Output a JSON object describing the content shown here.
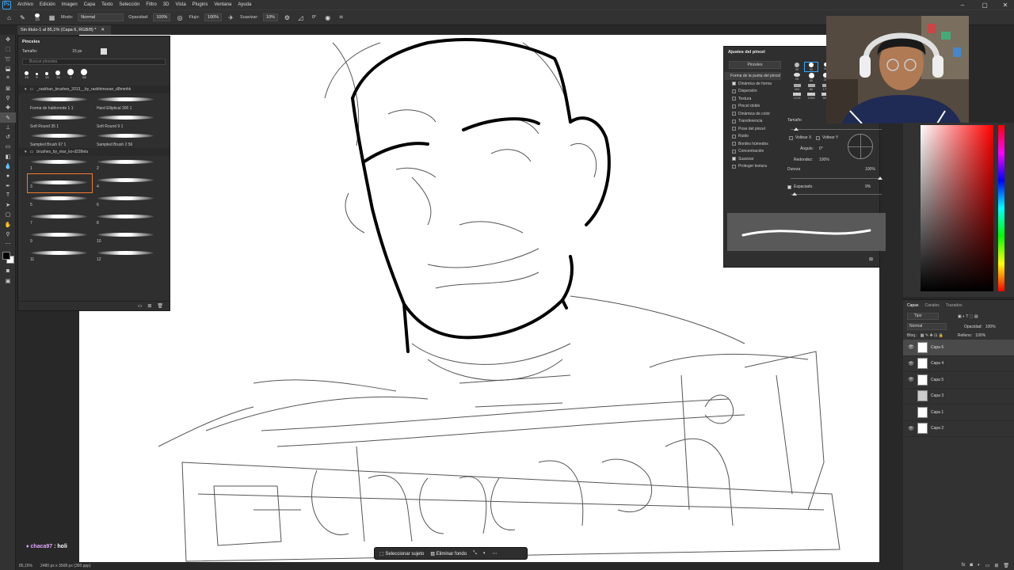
{
  "app": {
    "logo": "Ps",
    "menu": [
      "Archivo",
      "Edición",
      "Imagen",
      "Capa",
      "Texto",
      "Selección",
      "Filtro",
      "3D",
      "Vista",
      "Plugins",
      "Ventana",
      "Ayuda"
    ]
  },
  "options": {
    "brush_size": "15",
    "mode_label": "Modo:",
    "mode_value": "Normal",
    "opacity_label": "Opacidad:",
    "opacity_value": "100%",
    "flow_label": "Flujo:",
    "flow_value": "100%",
    "smooth_label": "Suavizar:",
    "smooth_value": "10%",
    "angle_value": "0°"
  },
  "document": {
    "tab_title": "Sin título-1 al 85,1% (Capa 6, RGB/8) *",
    "zoom": "85,15%",
    "dimensions": "2480 px x 3508 px (300 ppp)"
  },
  "brushes": {
    "title": "Pinceles",
    "size_label": "Tamaño:",
    "size_value": "15 px",
    "search_placeholder": "Buscar pinceles",
    "presets": [
      "15",
      "9",
      "13",
      "24",
      "1",
      "85"
    ],
    "group1": "_raskhan_brushes_2013__by_raskhimsean_d8mmhk",
    "group1_items": [
      "Forma de hablonnde 1 1",
      "Hard Elliptical 300 1",
      "Soft Round 35 1",
      "Soft Round 9 1",
      "Sampled Brush 67 1",
      "Sampled Brush 2 56"
    ],
    "group2": "brushes_by_mar_ko-d228ela",
    "group2_items": [
      "1",
      "2",
      "3",
      "4",
      "5",
      "6",
      "7",
      "8",
      "9",
      "10",
      "11",
      "12"
    ]
  },
  "brush_settings": {
    "title": "Ajustes del pincel",
    "tab_label": "Pinceles",
    "section_header": "Forma de la punta del pincel",
    "items": [
      {
        "label": "Dinámica de forma",
        "checked": true
      },
      {
        "label": "Dispersión",
        "checked": false
      },
      {
        "label": "Textura",
        "checked": false
      },
      {
        "label": "Pincel doble",
        "checked": false
      },
      {
        "label": "Dinámica de color",
        "checked": false
      },
      {
        "label": "Transferencia",
        "checked": false
      },
      {
        "label": "Pose del pincel",
        "checked": false
      },
      {
        "label": "Ruido",
        "checked": false
      },
      {
        "label": "Bordes húmedos",
        "checked": false
      },
      {
        "label": "Concentración",
        "checked": false
      },
      {
        "label": "Suavizar",
        "checked": true
      },
      {
        "label": "Proteger textura",
        "checked": false
      }
    ],
    "tip_sizes": [
      "30",
      "30",
      "30",
      "25",
      "50",
      "20",
      "284",
      "80",
      "174",
      "1215",
      "1005",
      "504"
    ],
    "size_label": "Tamaño",
    "flip_x": "Voltear X",
    "flip_y": "Voltear Y",
    "angle_label": "Ángulo:",
    "angle_value": "0°",
    "roundness_label": "Redondez:",
    "roundness_value": "100%",
    "hardness_label": "Dureza",
    "hardness_value": "100%",
    "spacing_label": "Espaciado",
    "spacing_value": "9%"
  },
  "layers": {
    "tabs": [
      "Capas",
      "Canales",
      "Trazados"
    ],
    "filter": "Tipo",
    "blend": "Normal",
    "opacity_label": "Opacidad:",
    "opacity_value": "100%",
    "lock_label": "Bloq.:",
    "fill_label": "Relleno:",
    "fill_value": "100%",
    "items": [
      {
        "name": "Capa 6",
        "visible": true,
        "selected": true
      },
      {
        "name": "Capa 4",
        "visible": true,
        "selected": false
      },
      {
        "name": "Capa 5",
        "visible": true,
        "selected": false
      },
      {
        "name": "Capa 3",
        "visible": false,
        "selected": false
      },
      {
        "name": "Capa 1",
        "visible": false,
        "selected": false
      },
      {
        "name": "Capa 2",
        "visible": true,
        "selected": false
      }
    ]
  },
  "context_bar": {
    "select_subject": "Seleccionar sujeto",
    "remove_bg": "Eliminar fondo"
  },
  "chat": {
    "user": "chaca97",
    "message": ": holi"
  },
  "colors": {
    "foreground": "#000000",
    "background": "#ffffff",
    "accent": "#31a8ff",
    "selection": "#f07c30"
  },
  "canvas_text": "chaca97"
}
